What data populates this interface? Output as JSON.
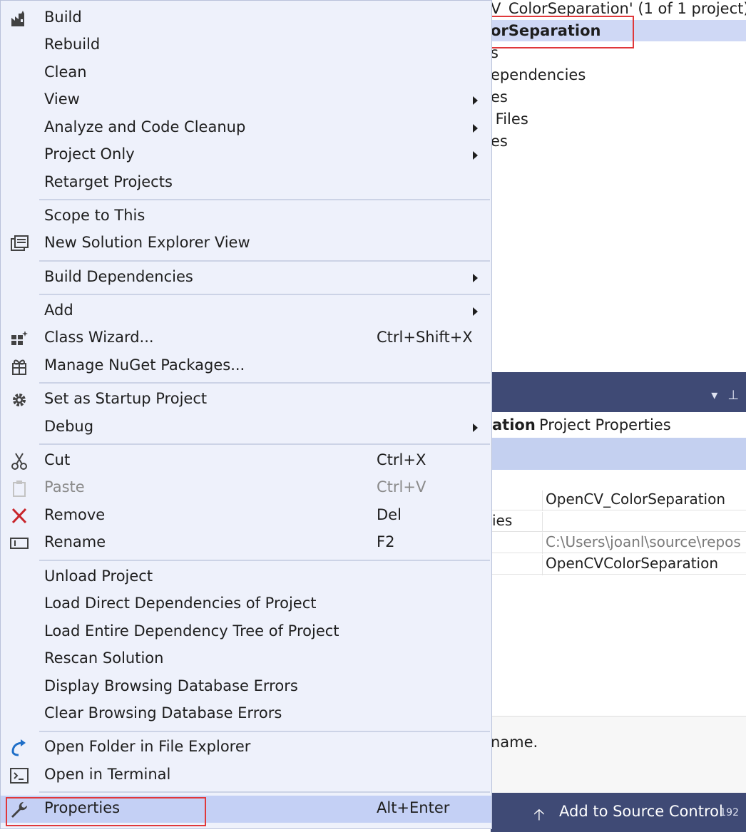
{
  "solution_explorer": {
    "header": "V_ColorSeparation' (1 of 1 project)",
    "selected": "orSeparation",
    "items": [
      "s",
      "ependencies",
      "es",
      " Files",
      "es"
    ]
  },
  "properties_panel": {
    "title_icons": [
      "▾",
      "⊥"
    ],
    "header_bold": "ation",
    "header_rest": "Project Properties",
    "rows": [
      {
        "key": "",
        "value": "OpenCV_ColorSeparation",
        "muted": false
      },
      {
        "key": "ies",
        "value": "",
        "muted": false
      },
      {
        "key": "",
        "value": "C:\\Users\\joanl\\source\\repos",
        "muted": true
      },
      {
        "key": "",
        "value": "OpenCVColorSeparation",
        "muted": false
      }
    ],
    "description": "name."
  },
  "statusbar": {
    "text": "Add to Source Control",
    "number": "192"
  },
  "menu": {
    "items": [
      {
        "label": "Build",
        "icon": "build-icon",
        "shortcut": "",
        "submenu": false
      },
      {
        "label": "Rebuild",
        "icon": "",
        "shortcut": "",
        "submenu": false
      },
      {
        "label": "Clean",
        "icon": "",
        "shortcut": "",
        "submenu": false
      },
      {
        "label": "View",
        "icon": "",
        "shortcut": "",
        "submenu": true
      },
      {
        "label": "Analyze and Code Cleanup",
        "icon": "",
        "shortcut": "",
        "submenu": true
      },
      {
        "label": "Project Only",
        "icon": "",
        "shortcut": "",
        "submenu": true
      },
      {
        "label": "Retarget Projects",
        "icon": "",
        "shortcut": "",
        "submenu": false
      },
      {
        "label": "Scope to This",
        "icon": "",
        "shortcut": "",
        "submenu": false
      },
      {
        "label": "New Solution Explorer View",
        "icon": "new-view-icon",
        "shortcut": "",
        "submenu": false
      },
      {
        "label": "Build Dependencies",
        "icon": "",
        "shortcut": "",
        "submenu": true
      },
      {
        "label": "Add",
        "icon": "",
        "shortcut": "",
        "submenu": true
      },
      {
        "label": "Class Wizard...",
        "icon": "class-wizard-icon",
        "shortcut": "Ctrl+Shift+X",
        "submenu": false
      },
      {
        "label": "Manage NuGet Packages...",
        "icon": "nuget-icon",
        "shortcut": "",
        "submenu": false
      },
      {
        "label": "Set as Startup Project",
        "icon": "gear-icon",
        "shortcut": "",
        "submenu": false
      },
      {
        "label": "Debug",
        "icon": "",
        "shortcut": "",
        "submenu": true
      },
      {
        "label": "Cut",
        "icon": "scissors-icon",
        "shortcut": "Ctrl+X",
        "submenu": false
      },
      {
        "label": "Paste",
        "icon": "clipboard-icon",
        "shortcut": "Ctrl+V",
        "submenu": false,
        "disabled": true
      },
      {
        "label": "Remove",
        "icon": "remove-x-icon",
        "shortcut": "Del",
        "submenu": false
      },
      {
        "label": "Rename",
        "icon": "rename-icon",
        "shortcut": "F2",
        "submenu": false
      },
      {
        "label": "Unload Project",
        "icon": "",
        "shortcut": "",
        "submenu": false
      },
      {
        "label": "Load Direct Dependencies of Project",
        "icon": "",
        "shortcut": "",
        "submenu": false
      },
      {
        "label": "Load Entire Dependency Tree of Project",
        "icon": "",
        "shortcut": "",
        "submenu": false
      },
      {
        "label": "Rescan Solution",
        "icon": "",
        "shortcut": "",
        "submenu": false
      },
      {
        "label": "Display Browsing Database Errors",
        "icon": "",
        "shortcut": "",
        "submenu": false
      },
      {
        "label": "Clear Browsing Database Errors",
        "icon": "",
        "shortcut": "",
        "submenu": false
      },
      {
        "label": "Open Folder in File Explorer",
        "icon": "open-folder-arrow-icon",
        "shortcut": "",
        "submenu": false
      },
      {
        "label": "Open in Terminal",
        "icon": "terminal-icon",
        "shortcut": "",
        "submenu": false
      },
      {
        "label": "Properties",
        "icon": "wrench-icon",
        "shortcut": "Alt+Enter",
        "submenu": false,
        "highlighted": true
      }
    ]
  },
  "colors": {
    "menu_bg": "#eef1fb",
    "highlight": "#c4d0f5",
    "annotation_red": "#e0383a",
    "panel_titlebar": "#3f4a75"
  }
}
